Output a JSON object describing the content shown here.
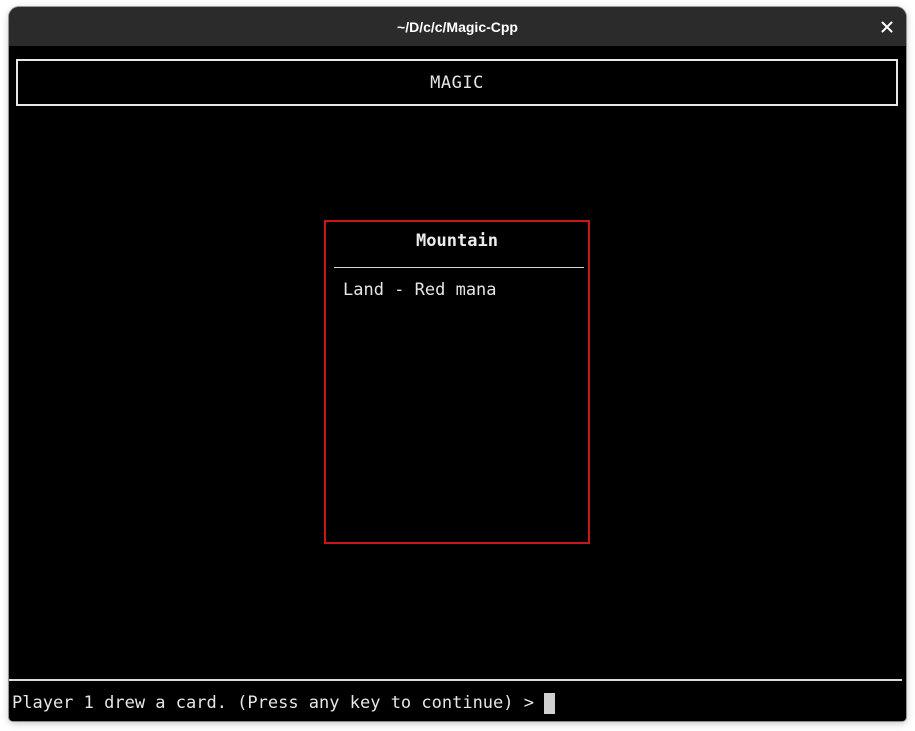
{
  "window": {
    "title": "~/D/c/c/Magic-Cpp",
    "close_icon": "close-icon"
  },
  "terminal": {
    "header_text": "MAGIC",
    "card": {
      "name": "Mountain",
      "type_line": "Land - Red mana",
      "border_color": "#c8161a"
    },
    "prompt_text": "Player 1 drew a card. (Press any key to continue) >"
  },
  "colors": {
    "background": "#000000",
    "text": "#e6e6e6",
    "card_border": "#c8161a",
    "titlebar": "#2b2b2b"
  }
}
